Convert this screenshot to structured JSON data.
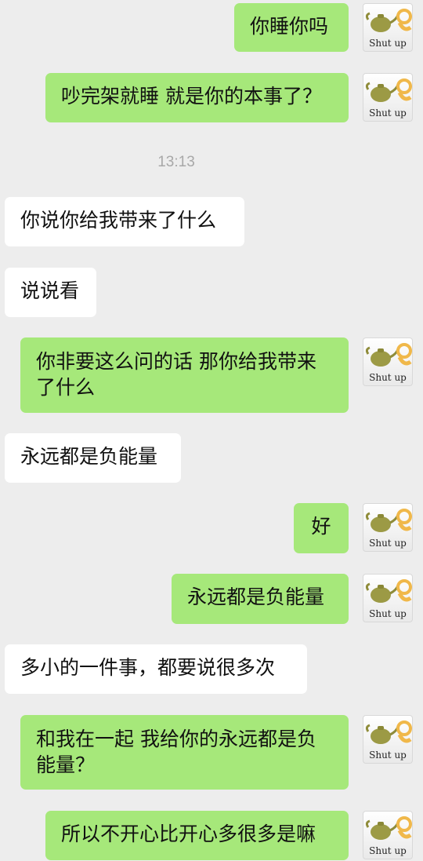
{
  "messages": [
    {
      "side": "out",
      "text": "你睡你吗",
      "avatar_caption": "Shut up",
      "avatar_icon": "teapot-ok-hand-icon"
    },
    {
      "side": "out",
      "text": "吵完架就睡 就是你的本事了？",
      "avatar_caption": "Shut up",
      "avatar_icon": "teapot-ok-hand-icon"
    },
    {
      "side": "in",
      "text": "你说你给我带来了什么"
    },
    {
      "side": "in",
      "text": "说说看"
    },
    {
      "side": "out",
      "text": "你非要这么问的话 那你给我带来了什么",
      "avatar_caption": "Shut up",
      "avatar_icon": "teapot-ok-hand-icon"
    },
    {
      "side": "in",
      "text": "永远都是负能量"
    },
    {
      "side": "out",
      "text": "好",
      "avatar_caption": "Shut up",
      "avatar_icon": "teapot-ok-hand-icon"
    },
    {
      "side": "out",
      "text": "永远都是负能量",
      "avatar_caption": "Shut up",
      "avatar_icon": "teapot-ok-hand-icon"
    },
    {
      "side": "in",
      "text": "多小的一件事，都要说很多次"
    },
    {
      "side": "out",
      "text": "和我在一起 我给你的永远都是负能量？",
      "avatar_caption": "Shut up",
      "avatar_icon": "teapot-ok-hand-icon"
    },
    {
      "side": "out",
      "text": "所以不开心比开心多很多是嘛",
      "avatar_caption": "Shut up",
      "avatar_icon": "teapot-ok-hand-icon"
    }
  ],
  "timestamp": "13:13",
  "colors": {
    "background": "#ededed",
    "outgoing_bubble": "#a6e87a",
    "incoming_bubble": "#ffffff",
    "timestamp_text": "#a8a8a8"
  }
}
